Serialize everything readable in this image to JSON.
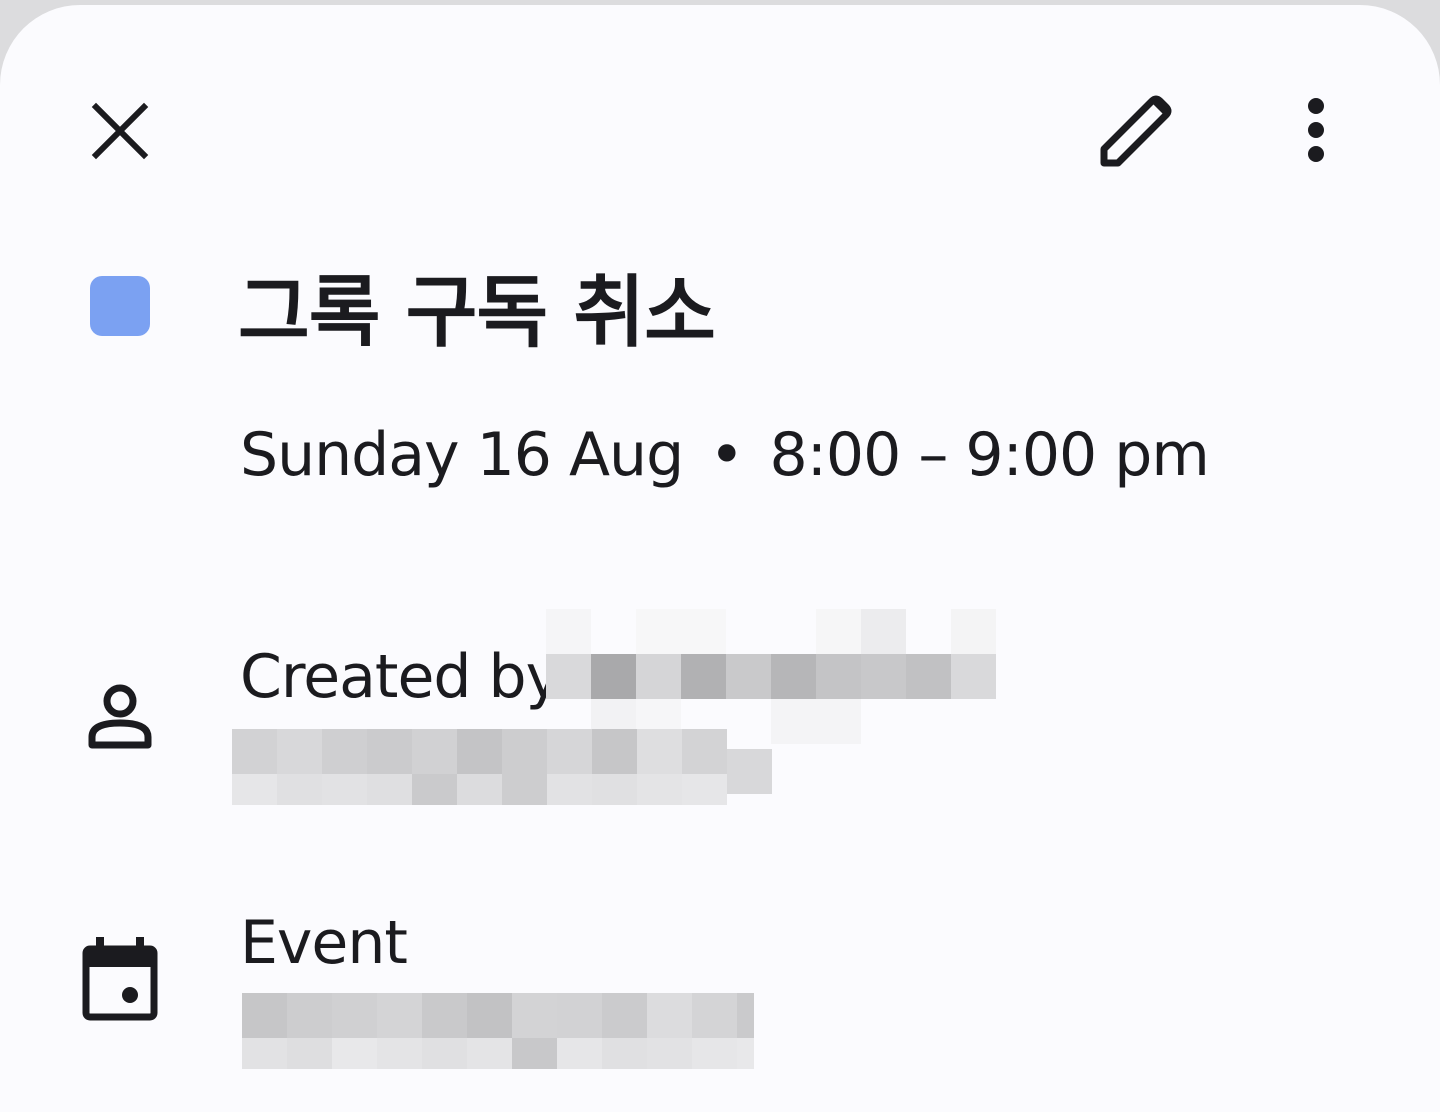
{
  "header": {
    "close_icon": "close-icon",
    "edit_icon": "pencil-icon",
    "more_icon": "more-vert-icon"
  },
  "event": {
    "color": "#7ba1f2",
    "title": "그록 구독 취소",
    "date": "Sunday 16 Aug",
    "separator": "•",
    "time": "8:00 – 9:00 pm"
  },
  "details": {
    "created_by_label": "Created by",
    "person_icon": "person-icon",
    "type_label": "Event",
    "calendar_icon": "calendar-icon"
  }
}
